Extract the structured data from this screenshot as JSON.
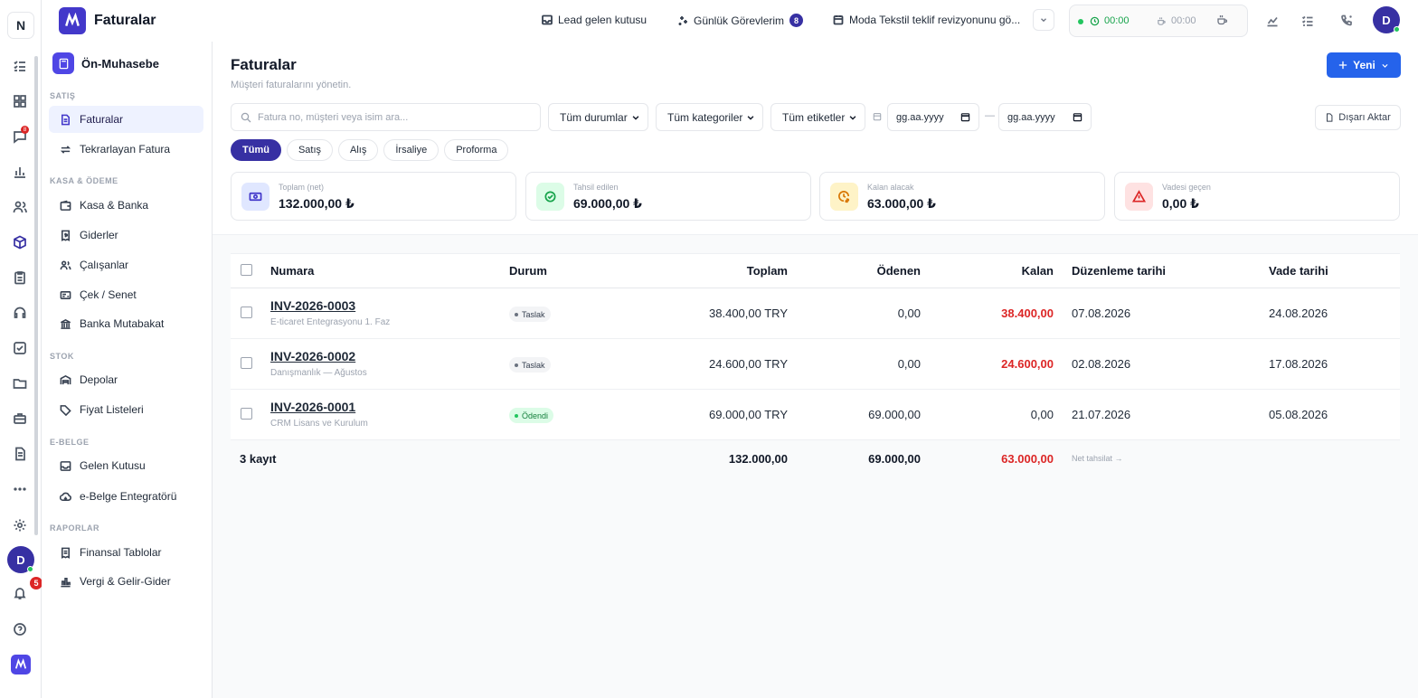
{
  "rail": {
    "logo_letter": "N",
    "avatar_letter": "D",
    "notification_count": "5",
    "chat_badge": "8"
  },
  "topbar": {
    "title": "Faturalar",
    "lead_inbox": "Lead gelen kutusu",
    "daily_tasks": "Günlük Görevlerim",
    "daily_tasks_count": "8",
    "event": "Moda Tekstil teklif revizyonunu gö...",
    "timer_active": "00:00",
    "timer_break": "00:00",
    "avatar_letter": "D"
  },
  "sidebar": {
    "module": "Ön-Muhasebe",
    "sections": {
      "sales": "SATIŞ",
      "cash": "KASA & ÖDEME",
      "stock": "STOK",
      "ebelge": "E-BELGE",
      "reports": "RAPORLAR"
    },
    "items": {
      "invoices": "Faturalar",
      "recurring": "Tekrarlayan Fatura",
      "cash_bank": "Kasa & Banka",
      "expenses": "Giderler",
      "employees": "Çalışanlar",
      "cheque": "Çek / Senet",
      "bank_recon": "Banka Mutabakat",
      "warehouses": "Depolar",
      "price_lists": "Fiyat Listeleri",
      "inbox": "Gelen Kutusu",
      "integrator": "e-Belge Entegratörü",
      "financial": "Finansal Tablolar",
      "tax": "Vergi & Gelir-Gider"
    }
  },
  "page": {
    "title": "Faturalar",
    "subtitle": "Müşteri faturalarını yönetin.",
    "new_button": "Yeni",
    "export_button": "Dışarı Aktar",
    "search_placeholder": "Fatura no, müşteri veya isim ara...",
    "filters": {
      "status": "Tüm durumlar",
      "category": "Tüm kategoriler",
      "tags": "Tüm etiketler",
      "date_from": "gg.aa.yyyy",
      "date_to": "gg.aa.yyyy",
      "date_sep": "—"
    },
    "tabs": [
      "Tümü",
      "Satış",
      "Alış",
      "İrsaliye",
      "Proforma"
    ],
    "active_tab": "Tümü"
  },
  "summary": [
    {
      "label": "Toplam (net)",
      "value": "132.000,00 ₺",
      "icon": "cash-icon",
      "bg": "#e0e7ff",
      "color": "#4338ca"
    },
    {
      "label": "Tahsil edilen",
      "value": "69.000,00 ₺",
      "icon": "check-circle-icon",
      "bg": "#dcfce7",
      "color": "#16a34a"
    },
    {
      "label": "Kalan alacak",
      "value": "63.000,00 ₺",
      "icon": "clock-money-icon",
      "bg": "#fef3c7",
      "color": "#d97706"
    },
    {
      "label": "Vadesi geçen",
      "value": "0,00 ₺",
      "icon": "warning-icon",
      "bg": "#fee2e2",
      "color": "#dc2626"
    }
  ],
  "table": {
    "headers": {
      "number": "Numara",
      "status": "Durum",
      "total": "Toplam",
      "paid": "Ödenen",
      "remaining": "Kalan",
      "issue_date": "Düzenleme tarihi",
      "due_date": "Vade tarihi"
    },
    "rows": [
      {
        "number": "INV-2026-0003",
        "desc": "E-ticaret Entegrasyonu 1. Faz",
        "status": "Taslak",
        "status_color": "#6b7280",
        "total": "38.400,00 TRY",
        "paid": "0,00",
        "remaining": "38.400,00",
        "issue_date": "07.08.2026",
        "due_date": "24.08.2026"
      },
      {
        "number": "INV-2026-0002",
        "desc": "Danışmanlık — Ağustos",
        "status": "Taslak",
        "status_color": "#6b7280",
        "total": "24.600,00 TRY",
        "paid": "0,00",
        "remaining": "24.600,00",
        "issue_date": "02.08.2026",
        "due_date": "17.08.2026"
      },
      {
        "number": "INV-2026-0001",
        "desc": "CRM Lisans ve Kurulum",
        "status": "Ödendi",
        "status_color": "#22c55e",
        "total": "69.000,00 TRY",
        "paid": "69.000,00",
        "remaining": "0,00",
        "issue_date": "21.07.2026",
        "due_date": "05.08.2026"
      }
    ],
    "footer": {
      "count": "3 kayıt",
      "total": "132.000,00",
      "paid": "69.000,00",
      "remaining": "63.000,00",
      "net_label": "Net tahsilat →"
    }
  },
  "colors": {
    "primary": "#3730a3",
    "accent_blue": "#2563eb",
    "danger": "#dc2626",
    "success": "#22c55e"
  }
}
